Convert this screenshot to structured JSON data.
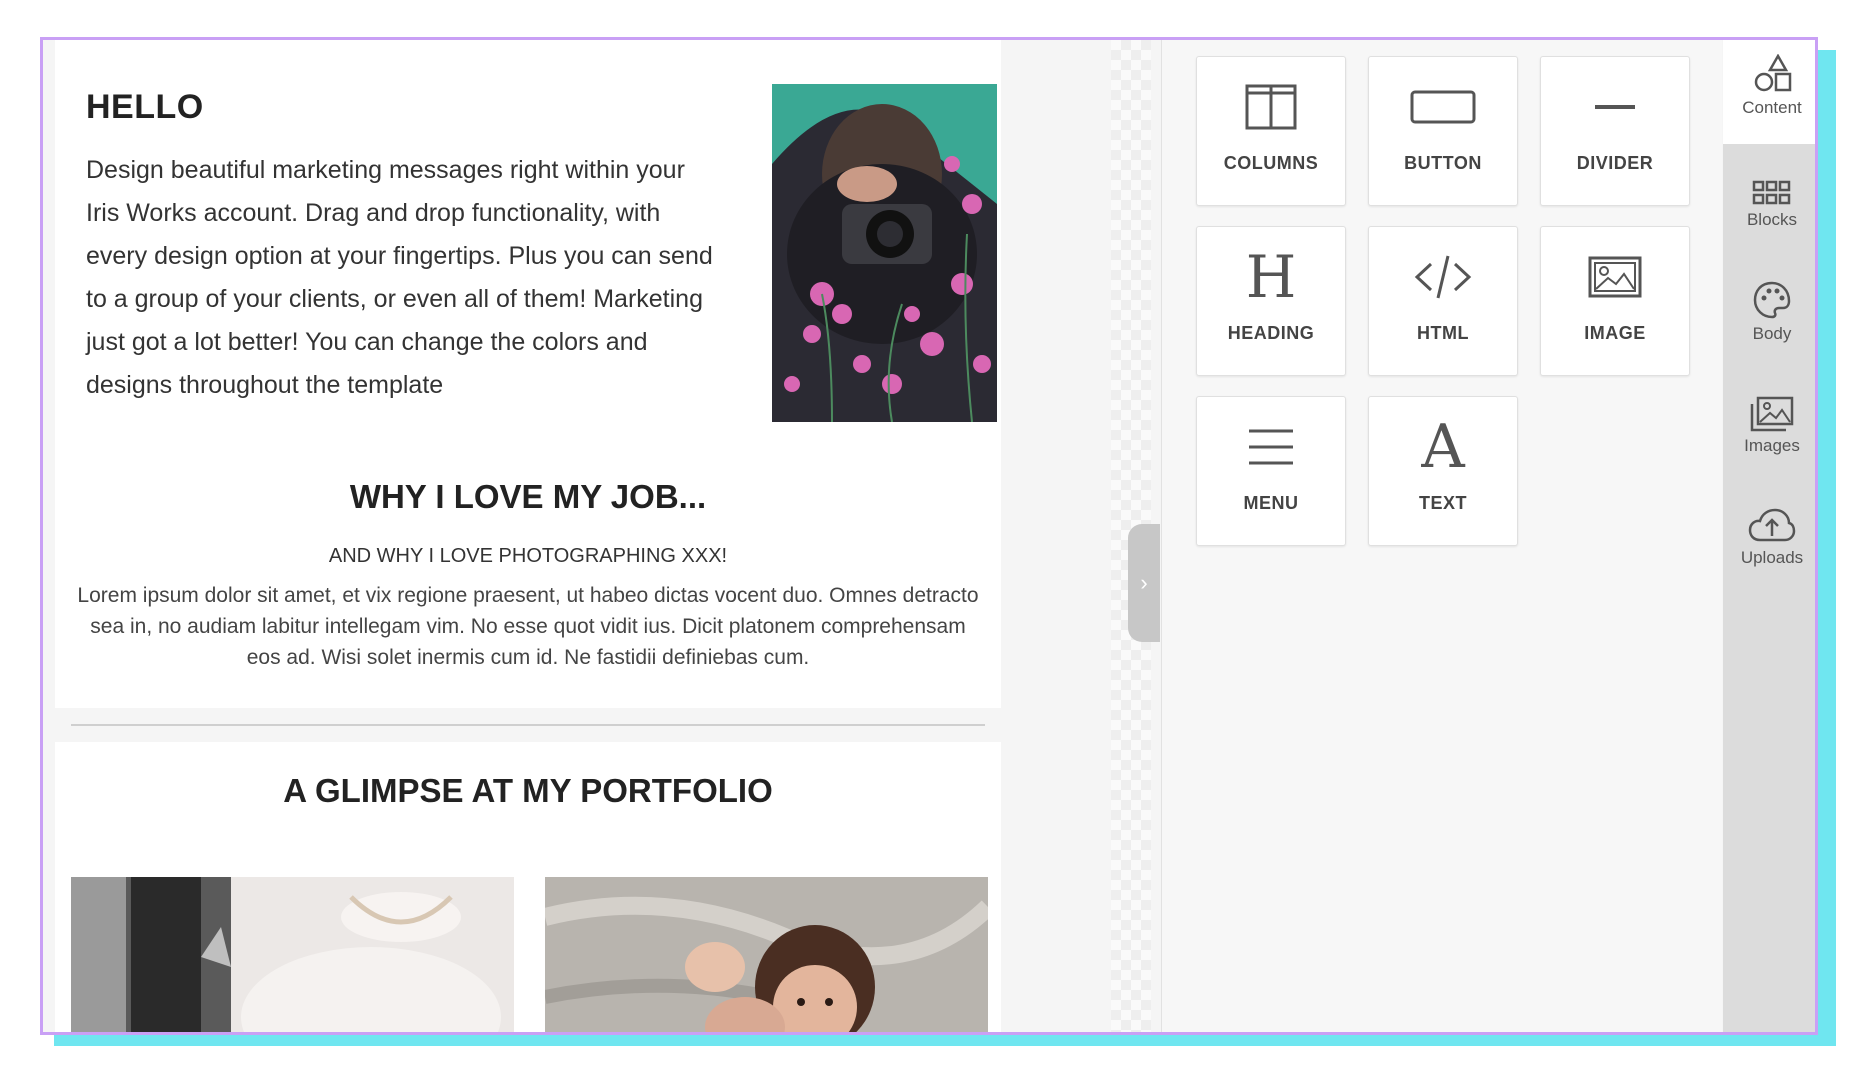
{
  "email": {
    "hello": "HELLO",
    "intro": "Design beautiful marketing messages right within your Iris Works account. Drag and drop functionality, with every design option at your fingertips. Plus you can send to a group of your clients, or even all of them! Marketing just got a lot better! You can change the colors and designs throughout the template",
    "why_heading": "WHY I LOVE MY JOB...",
    "why_sub": "AND WHY I LOVE PHOTOGRAPHING XXX!",
    "lorem": "Lorem ipsum dolor sit amet, et vix regione praesent, ut habeo dictas vocent duo. Omnes detracto sea in, no audiam labitur intellegam vim. No esse quot vidit ius. Dicit platonem comprehensam eos ad. Wisi solet inermis cum id. Ne fastidii definiebas cum.",
    "portfolio_heading": "A GLIMPSE AT MY PORTFOLIO"
  },
  "content_tools": [
    {
      "label": "COLUMNS",
      "icon": "columns-icon"
    },
    {
      "label": "BUTTON",
      "icon": "button-icon"
    },
    {
      "label": "DIVIDER",
      "icon": "divider-icon"
    },
    {
      "label": "HEADING",
      "icon": "heading-icon"
    },
    {
      "label": "HTML",
      "icon": "code-icon"
    },
    {
      "label": "IMAGE",
      "icon": "image-icon"
    },
    {
      "label": "MENU",
      "icon": "menu-icon"
    },
    {
      "label": "TEXT",
      "icon": "text-icon"
    }
  ],
  "sidebar": {
    "items": [
      {
        "label": "Content",
        "icon": "shapes-icon",
        "active": true
      },
      {
        "label": "Blocks",
        "icon": "grid-icon"
      },
      {
        "label": "Body",
        "icon": "palette-icon"
      },
      {
        "label": "Images",
        "icon": "gallery-icon"
      },
      {
        "label": "Uploads",
        "icon": "cloud-upload-icon"
      }
    ]
  },
  "colors": {
    "frame_border": "#c9a0f5",
    "frame_shadow": "#6fe6f0"
  }
}
